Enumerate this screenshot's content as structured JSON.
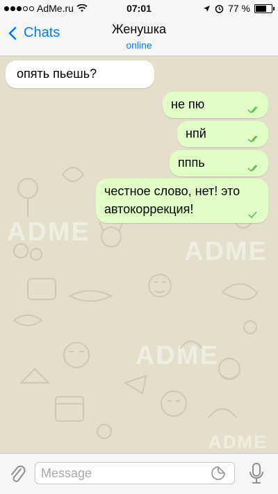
{
  "status_bar": {
    "carrier": "AdMe.ru",
    "time": "07:01",
    "battery_text": "77 %",
    "battery_level": 0.77
  },
  "nav": {
    "back_label": "Chats",
    "title": "Женушка",
    "subtitle": "online"
  },
  "watermarks": [
    "ADME",
    "ADME",
    "ADME",
    "ADME"
  ],
  "messages": [
    {
      "direction": "in",
      "text": "опять пьешь?"
    },
    {
      "direction": "out",
      "text": "не пю",
      "status": "read"
    },
    {
      "direction": "out",
      "text": "нпй",
      "status": "read"
    },
    {
      "direction": "out",
      "text": "пппь",
      "status": "read"
    },
    {
      "direction": "out",
      "line1": "честное слово, нет! это",
      "line2": "автокоррекция!",
      "status": "delivered"
    }
  ],
  "input": {
    "placeholder": "Message",
    "value": ""
  },
  "colors": {
    "accent": "#007aff",
    "incoming_bubble": "#ffffff",
    "outgoing_bubble": "#e1fec6",
    "read_tick": "#5bbd4f",
    "chat_background": "#e4dfcb"
  },
  "icons": {
    "back": "chevron-left-icon",
    "attach": "paperclip-icon",
    "sticker": "sticker-icon",
    "voice": "microphone-icon",
    "wifi": "wifi-icon",
    "location": "location-arrow-icon",
    "alarm": "alarm-icon",
    "battery": "battery-icon"
  }
}
